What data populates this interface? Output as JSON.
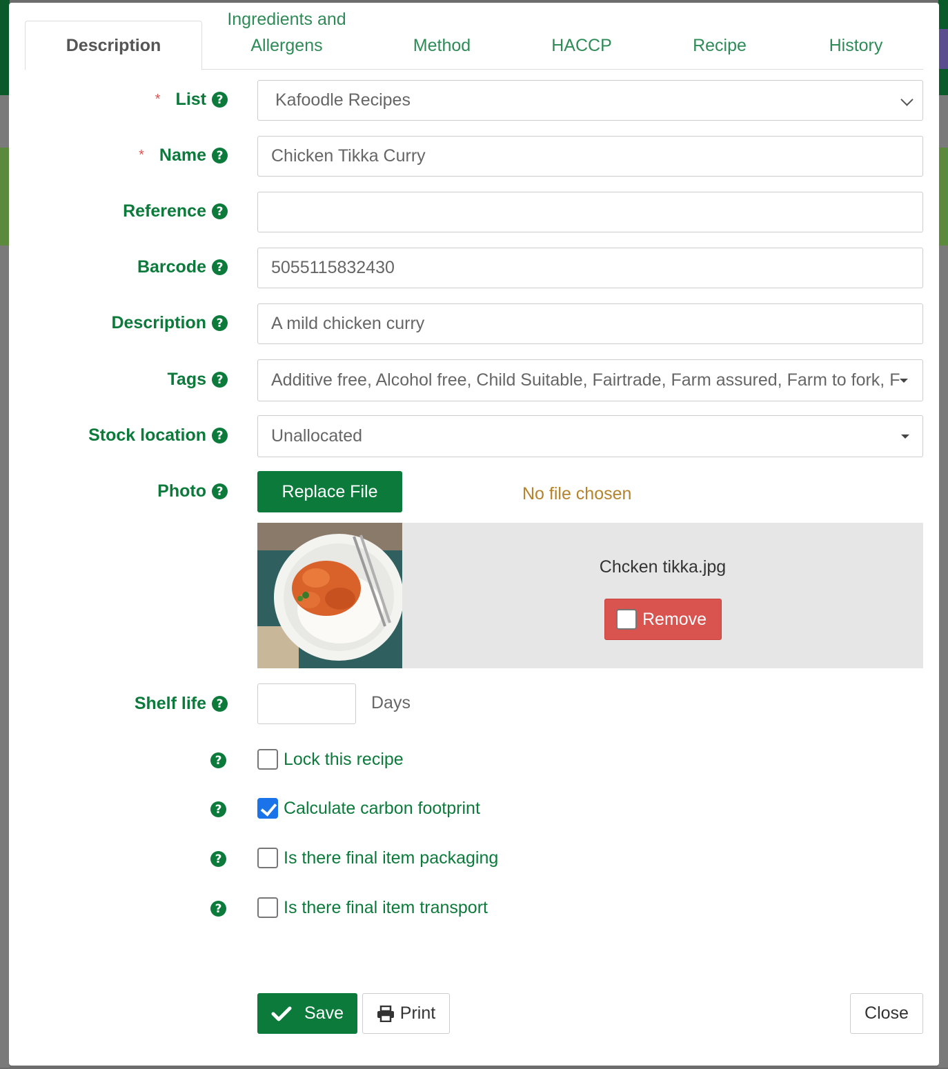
{
  "tabs": [
    {
      "label": "Description",
      "active": true
    },
    {
      "label": "Ingredients and Allergens",
      "active": false
    },
    {
      "label": "Method",
      "active": false
    },
    {
      "label": "HACCP",
      "active": false
    },
    {
      "label": "Recipe",
      "active": false
    },
    {
      "label": "History",
      "active": false
    }
  ],
  "form": {
    "list": {
      "label": "List",
      "required": true,
      "value": "Kafoodle Recipes"
    },
    "name": {
      "label": "Name",
      "required": true,
      "value": "Chicken Tikka Curry"
    },
    "reference": {
      "label": "Reference",
      "value": ""
    },
    "barcode": {
      "label": "Barcode",
      "value": "5055115832430"
    },
    "description": {
      "label": "Description",
      "value": "A mild chicken curry"
    },
    "tags": {
      "label": "Tags",
      "value": "Additive free, Alcohol free, Child Suitable, Fairtrade, Farm assured, Farm to fork, F"
    },
    "stock_location": {
      "label": "Stock location",
      "value": "Unallocated"
    },
    "photo": {
      "label": "Photo",
      "replace_label": "Replace File",
      "no_file_text": "No file chosen",
      "filename": "Chcken tikka.jpg",
      "remove_label": "Remove"
    },
    "shelf_life": {
      "label": "Shelf life",
      "value": "",
      "unit": "Days"
    },
    "checkboxes": [
      {
        "label": "Lock this recipe",
        "checked": false
      },
      {
        "label": "Calculate carbon footprint",
        "checked": true
      },
      {
        "label": "Is there final item packaging",
        "checked": false
      },
      {
        "label": "Is there final item transport",
        "checked": false
      }
    ]
  },
  "footer": {
    "save_label": "Save",
    "print_label": "Print",
    "close_label": "Close"
  },
  "colors": {
    "brand_green": "#0b7a3b",
    "tab_green": "#2e8b57",
    "danger": "#d9534f",
    "checkbox_blue": "#1a73e8"
  }
}
